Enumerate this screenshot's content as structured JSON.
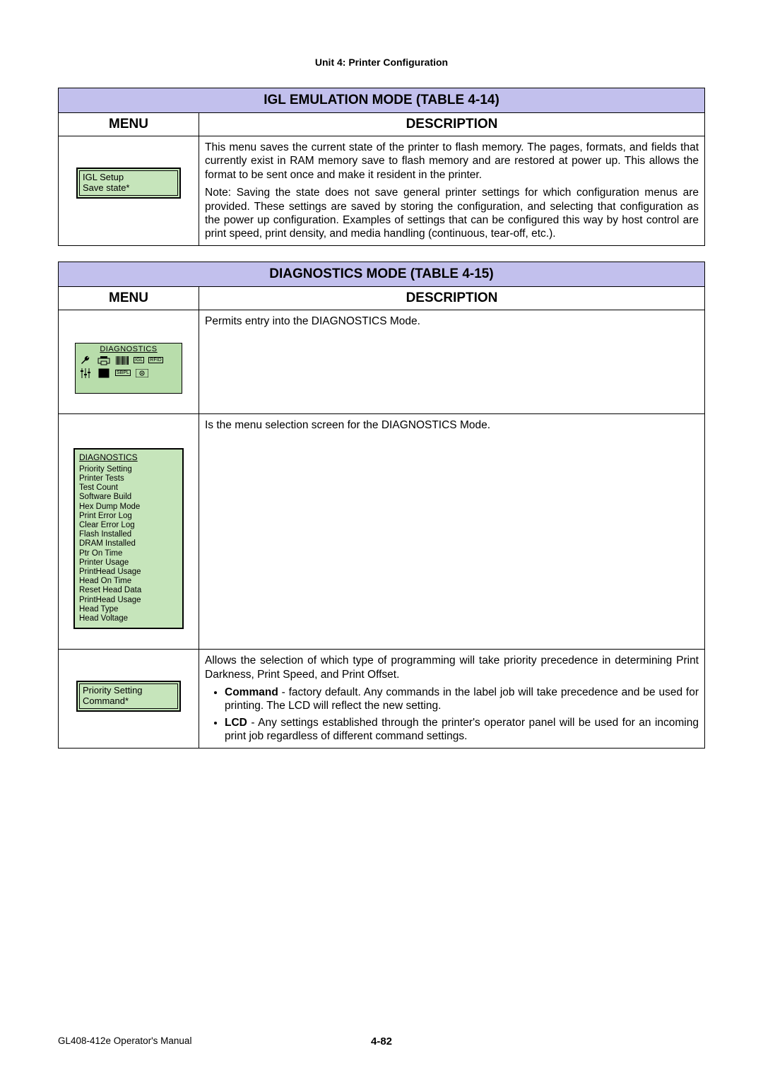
{
  "header": {
    "unit": "Unit 4:  Printer Configuration"
  },
  "table1": {
    "title": "IGL EMULATION MODE (TABLE 4-14)",
    "menu_hdr": "MENU",
    "desc_hdr": "DESCRIPTION",
    "rows": [
      {
        "lcd": {
          "line1": "IGL Setup",
          "line2": "Save state*"
        },
        "desc_p1": "This menu saves the current state of the printer to flash memory. The pages, formats, and fields that currently exist in RAM memory save to flash memory and are restored at power up. This allows the format to be sent once and make it resident in the printer.",
        "desc_p2": "Note: Saving the state does not save general printer settings for which configuration menus are provided. These settings are saved by storing the configuration, and selecting that configuration as the power up configuration. Examples of settings that can be configured this way by host control are print speed, print density, and media handling (continuous, tear-off, etc.)."
      }
    ]
  },
  "table2": {
    "title": "DIAGNOSTICS MODE (TABLE 4-15)",
    "menu_hdr": "MENU",
    "desc_hdr": "DESCRIPTION",
    "rows": [
      {
        "kind": "iconbox",
        "lcd_title": "DIAGNOSTICS",
        "badges": [
          "RFID",
          "IGL",
          "SBPL",
          "SCAN"
        ],
        "desc": "Permits entry into the DIAGNOSTICS Mode."
      },
      {
        "kind": "listbox",
        "lcd_title": "DIAGNOSTICS",
        "items": [
          "Priority Setting",
          "Printer Tests",
          "Test Count",
          "Software Build",
          "Hex Dump Mode",
          "Print Error Log",
          "Clear Error Log",
          "Flash Installed",
          "DRAM Installed",
          "Ptr On Time",
          "Printer Usage",
          "PrintHead Usage",
          "Head On Time",
          "Reset Head Data",
          "PrintHead Usage",
          "Head Type",
          "Head Voltage"
        ],
        "desc": "Is the menu selection screen for the DIAGNOSTICS Mode."
      },
      {
        "kind": "smallbox",
        "lcd": {
          "line1": "Priority Setting",
          "line2": "Command*"
        },
        "desc_intro": "Allows the selection of which type of programming will take priority precedence in determining Print Darkness, Print Speed, and Print Offset.",
        "bullets": [
          {
            "bold": "Command",
            "rest": " - factory default. Any commands in the label job will take precedence and be used for printing. The LCD will reflect the new setting."
          },
          {
            "bold": "LCD",
            "rest": " - Any settings established through the printer's operator panel will be used for an incoming print job regardless of different command settings."
          }
        ]
      }
    ]
  },
  "footer": {
    "left": "GL408-412e Operator's Manual",
    "page": "4-82"
  }
}
